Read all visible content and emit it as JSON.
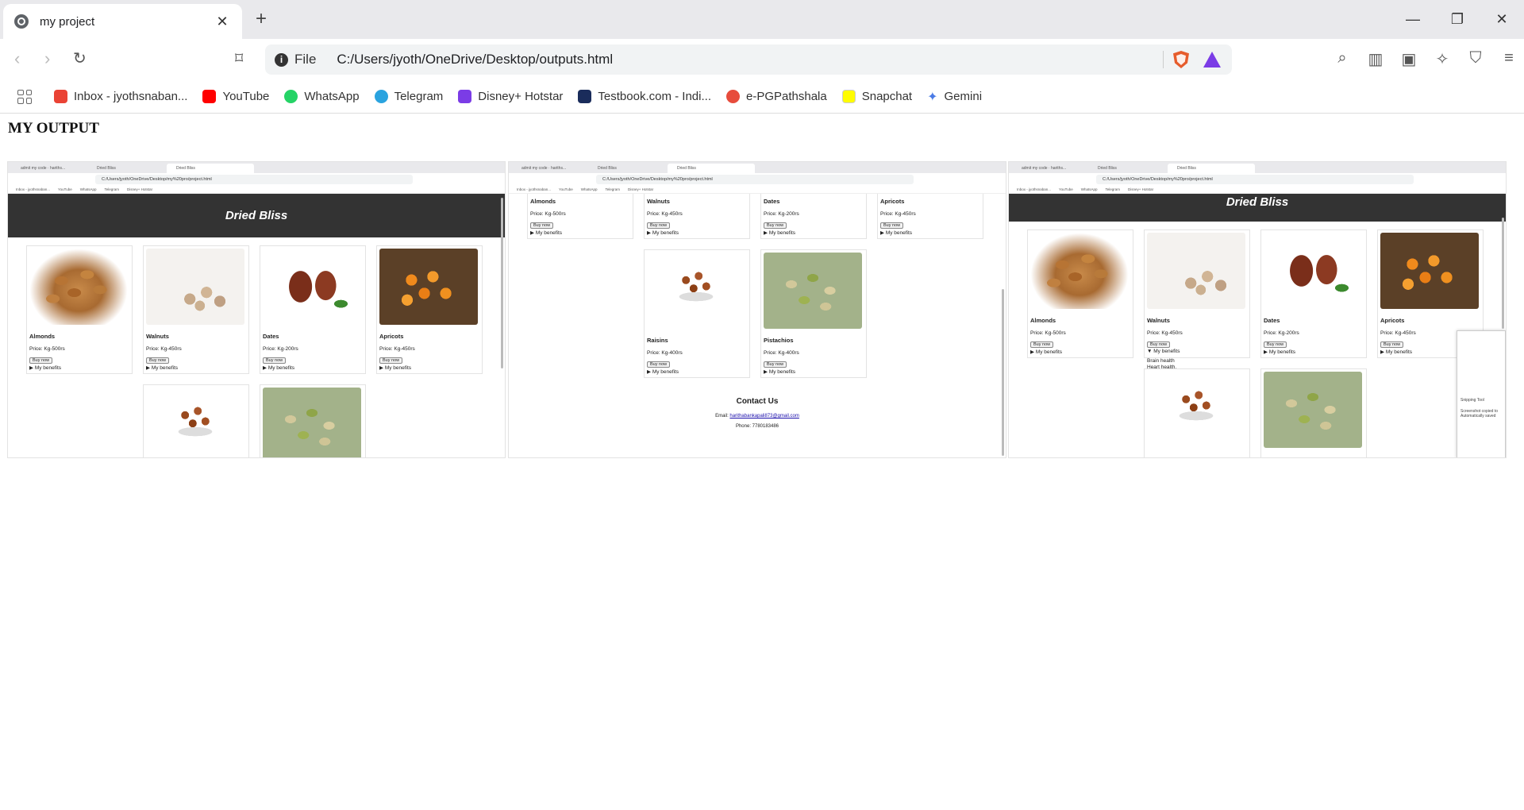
{
  "browser": {
    "tab_title": "my project",
    "new_tab": "+",
    "url_scheme": "File",
    "url": "C:/Users/jyoth/OneDrive/Desktop/outputs.html",
    "bookmarks": [
      {
        "label": "Inbox - jyothsnaban...",
        "color": "#ea4335"
      },
      {
        "label": "YouTube",
        "color": "#ff0000"
      },
      {
        "label": "WhatsApp",
        "color": "#25d366"
      },
      {
        "label": "Telegram",
        "color": "#2aa3df"
      },
      {
        "label": "Disney+ Hotstar",
        "color": "#7b3ce6"
      },
      {
        "label": "Testbook.com - Indi...",
        "color": "#1a2c5b"
      },
      {
        "label": "e-PGPathshala",
        "color": "#e74c3c"
      },
      {
        "label": "Snapchat",
        "color": "#fffc00"
      },
      {
        "label": "Gemini",
        "color": "#4a7be6"
      }
    ]
  },
  "page": {
    "title": "MY OUTPUT"
  },
  "shots": [
    {
      "mini_url": "C:/Users/jyoth/OneDrive/Desktop/my%20pro/project.html",
      "tabs": [
        "admit my code · hariths...",
        "Dried Bliss",
        "Dried Bliss"
      ]
    },
    {
      "mini_url": "C:/Users/jyoth/OneDrive/Desktop/my%20pro/project.html",
      "tabs": [
        "admit my code · hariths...",
        "Dried Bliss",
        "Dried Bliss"
      ]
    },
    {
      "mini_url": "C:/Users/jyoth/OneDrive/Desktop/my%20pro/project.html",
      "tabs": [
        "admit my code · hariths...",
        "Dried Bliss",
        "Dried Bliss"
      ]
    }
  ],
  "site": {
    "header": "Dried Bliss",
    "buy_label": "Buy now",
    "benefits_label": "My benefits",
    "products": [
      {
        "name": "Almonds",
        "price": "Price: Kg-500rs"
      },
      {
        "name": "Walnuts",
        "price": "Price: Kg-450rs"
      },
      {
        "name": "Dates",
        "price": "Price: Kg-200rs"
      },
      {
        "name": "Apricots",
        "price": "Price: Kg-450rs"
      },
      {
        "name": "Raisins",
        "price": "Price: Kg-400rs"
      },
      {
        "name": "Pistachios",
        "price": "Price: Kg-400rs"
      }
    ],
    "walnut_benefits": [
      "Brain health",
      "Heart health."
    ],
    "contact": {
      "heading": "Contact Us",
      "email_label": "Email:",
      "email": "harithabankapali873@gmail.com",
      "phone": "Phone: 7780183486"
    },
    "snip": {
      "title": "Snipping Tool",
      "line1": "Screenshot copied to",
      "line2": "Automatically saved"
    }
  }
}
